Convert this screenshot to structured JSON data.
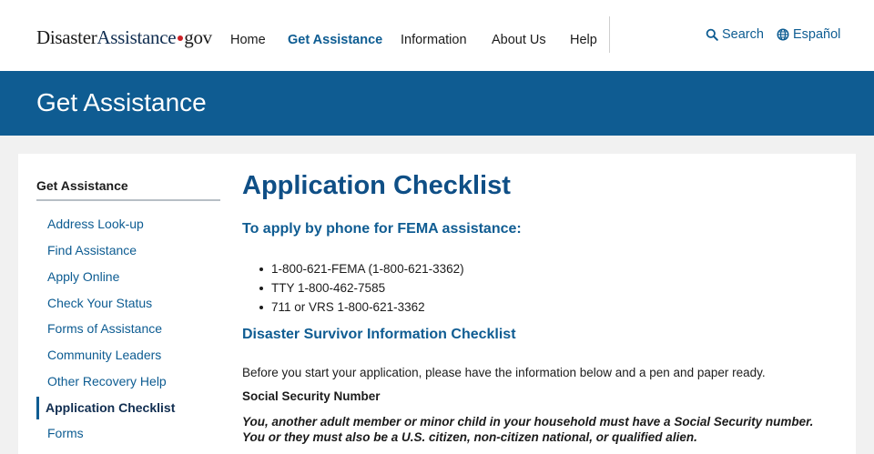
{
  "header": {
    "logo": {
      "part1": "Disaster",
      "part2": "Assistance",
      "part3": "gov"
    },
    "nav": [
      "Home",
      "Get Assistance",
      "Information",
      "About Us",
      "Help"
    ],
    "active_nav": "Get Assistance",
    "search_label": "Search",
    "language_label": "Español"
  },
  "hero": {
    "title": "Get Assistance"
  },
  "sidebar": {
    "heading": "Get Assistance",
    "items": [
      "Address Look-up",
      "Find Assistance",
      "Apply Online",
      "Check Your Status",
      "Forms of Assistance",
      "Community Leaders",
      "Other Recovery Help",
      "Application Checklist",
      "Forms"
    ],
    "active_item": "Application Checklist"
  },
  "main": {
    "title": "Application Checklist",
    "phone_heading": "To apply by phone for FEMA assistance:",
    "phones": [
      "1-800-621-FEMA (1-800-621-3362)",
      "TTY 1-800-462-7585",
      "711 or VRS 1-800-621-3362"
    ],
    "checklist_heading": "Disaster Survivor Information Checklist",
    "intro": "Before you start your application, please have the information below and a pen and paper ready.",
    "ssn_label": "Social Security Number",
    "ssn_note_line1": "You, another adult member or minor child in your household must have a Social Security number.",
    "ssn_note_line2": "You or they must also be a U.S. citizen, non-citizen national, or qualified alien."
  },
  "colors": {
    "brand_blue": "#0f5c92",
    "link_blue": "#0d5c92",
    "heading_blue": "#0f4f86",
    "logo_dot_red": "#cd2026"
  }
}
